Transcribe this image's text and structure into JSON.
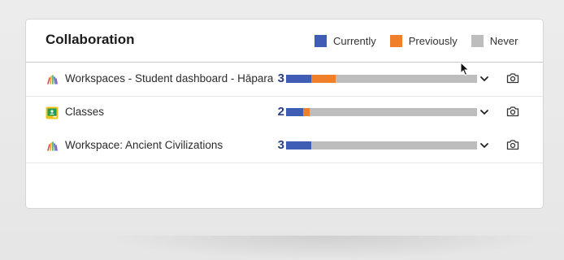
{
  "card": {
    "title": "Collaboration"
  },
  "legend": [
    {
      "label": "Currently",
      "color": "#3f5db5"
    },
    {
      "label": "Previously",
      "color": "#f07f2a"
    },
    {
      "label": "Never",
      "color": "#bdbdbd"
    }
  ],
  "rows": [
    {
      "name": "Workspaces - Student dashboard - Hāpara",
      "count": "3",
      "icon": "hapara-workspace-icon",
      "bar": {
        "currently": 0.13,
        "previously": 0.13,
        "never": 0.74
      }
    },
    {
      "name": "Classes",
      "count": "2",
      "icon": "google-classroom-icon",
      "bar": {
        "currently": 0.09,
        "previously": 0.035,
        "never": 0.875
      }
    },
    {
      "name": "Workspace: Ancient Civilizations",
      "count": "3",
      "icon": "hapara-workspace-icon",
      "bar": {
        "currently": 0.13,
        "previously": 0.0,
        "never": 0.87
      }
    }
  ],
  "actions": {
    "expand_icon": "chevron-down-icon",
    "snapshot_icon": "camera-icon"
  }
}
